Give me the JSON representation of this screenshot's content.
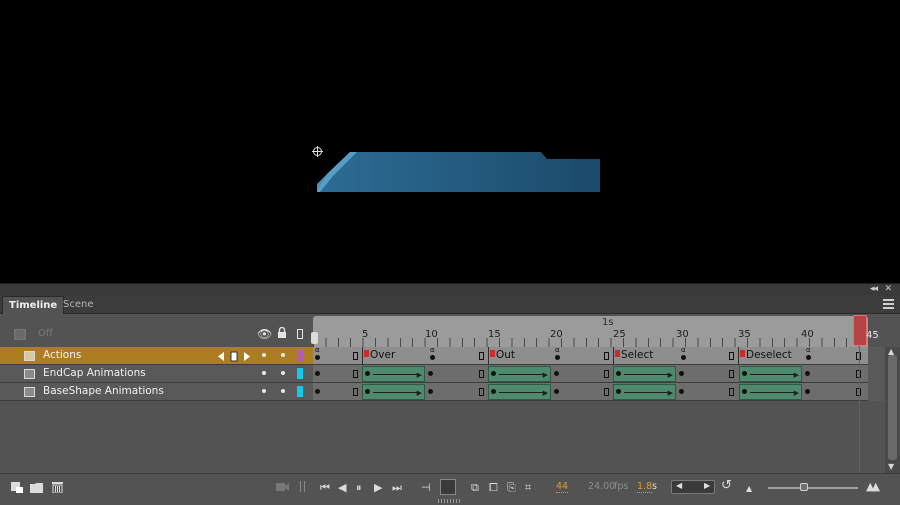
{
  "panel": {
    "tabs": [
      {
        "label": "Timeline",
        "active": true
      },
      {
        "label": "Scene",
        "active": false
      }
    ],
    "collapse_glyph": "◂◂",
    "close_glyph": "✕"
  },
  "layers_header": {
    "parent_toggle_label": "Off"
  },
  "layers": [
    {
      "name": "Actions",
      "selected": true,
      "outline_color": "#b05bb6"
    },
    {
      "name": "EndCap Animations",
      "selected": false,
      "outline_color": "#11c9e8"
    },
    {
      "name": "BaseShape Animations",
      "selected": false,
      "outline_color": "#11c9e8"
    }
  ],
  "ruler": {
    "ticks": [
      "5",
      "10",
      "15",
      "20",
      "25",
      "30",
      "35",
      "40",
      "45"
    ],
    "second_marker": "1s",
    "current_frame_marker": "45"
  },
  "frame_labels": [
    "Over",
    "Out",
    "Select",
    "Deselect"
  ],
  "toolbar": {
    "current_frame": "44",
    "fps": "24.00",
    "fps_unit": "fps",
    "elapsed": "1.8",
    "elapsed_unit": "s"
  },
  "colors": {
    "selected_layer": "#ad7e21",
    "tween": "#4f8a6f",
    "playhead": "#c03a3a",
    "accent_value": "#e39a2b"
  }
}
